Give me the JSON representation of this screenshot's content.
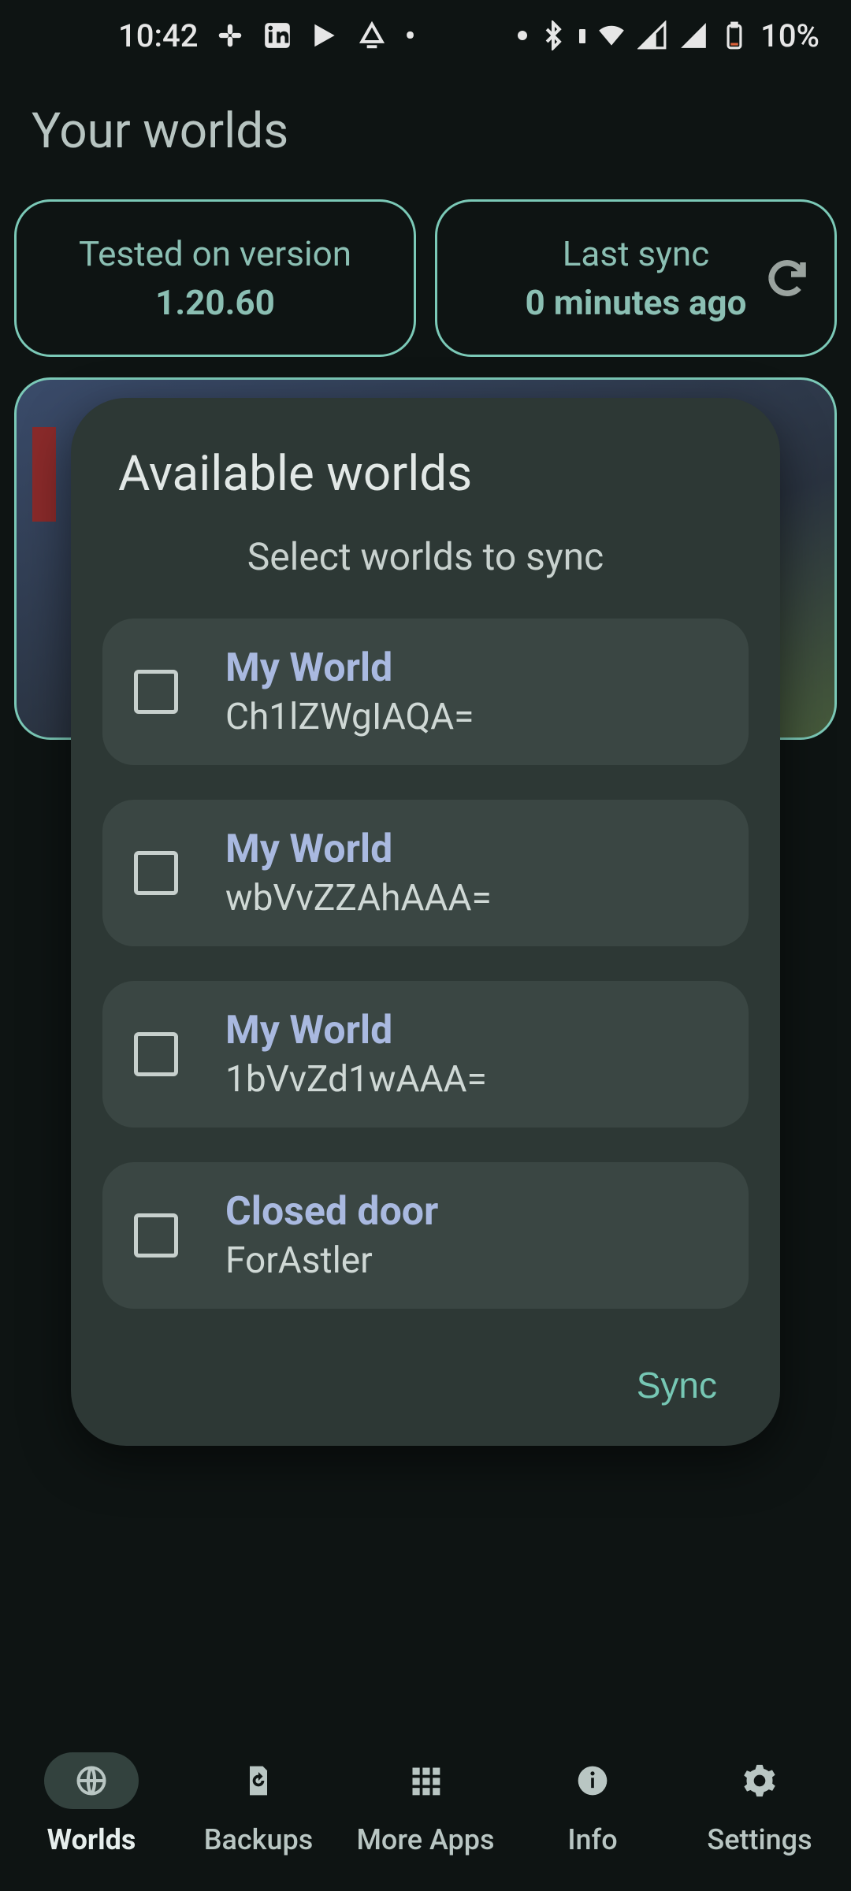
{
  "status": {
    "time": "10:42",
    "battery_text": "10%"
  },
  "header": {
    "title": "Your worlds"
  },
  "info_cards": {
    "version": {
      "label": "Tested on version",
      "value": "1.20.60"
    },
    "sync": {
      "label": "Last sync",
      "value": "0 minutes ago"
    }
  },
  "dialog": {
    "title": "Available worlds",
    "subtitle": "Select worlds to sync",
    "items": [
      {
        "name": "My World",
        "id": "Ch1lZWgIAQA="
      },
      {
        "name": "My World",
        "id": "wbVvZZAhAAA="
      },
      {
        "name": "My World",
        "id": "1bVvZd1wAAA="
      },
      {
        "name": "Closed door",
        "id": "ForAstler"
      }
    ],
    "action": "Sync"
  },
  "nav": {
    "worlds": "Worlds",
    "backups": "Backups",
    "moreapps": "More Apps",
    "info": "Info",
    "settings": "Settings"
  }
}
